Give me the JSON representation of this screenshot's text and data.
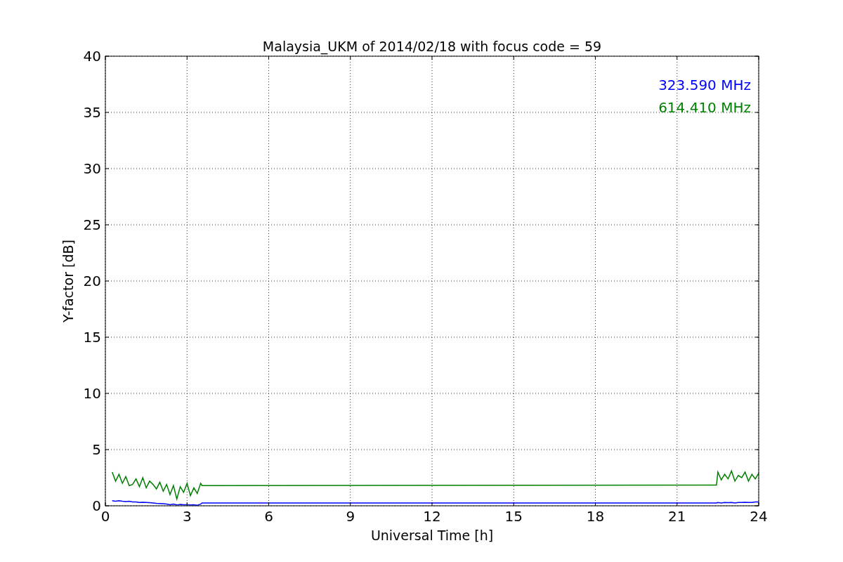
{
  "figure": {
    "chart_data": {
      "type": "line",
      "title": "Malaysia_UKM of 2014/02/18 with focus code = 59",
      "xlabel": "Universal Time [h]",
      "ylabel": "Y-factor [dB]",
      "x": [
        0.25,
        0.375,
        0.5,
        0.625,
        0.75,
        0.875,
        1,
        1.125,
        1.25,
        1.375,
        1.5,
        1.625,
        1.75,
        1.875,
        2,
        2.125,
        2.25,
        2.375,
        2.5,
        2.625,
        2.75,
        2.875,
        3,
        3.125,
        3.25,
        3.375,
        3.5,
        3.55,
        22.45,
        22.5,
        22.625,
        22.75,
        22.875,
        23,
        23.125,
        23.25,
        23.375,
        23.5,
        23.625,
        23.75,
        23.875,
        24
      ],
      "series": [
        {
          "name": "323.590 MHz",
          "color": "#0000ff",
          "values": [
            0.45,
            0.4,
            0.45,
            0.4,
            0.38,
            0.4,
            0.35,
            0.35,
            0.3,
            0.32,
            0.3,
            0.28,
            0.25,
            0.22,
            0.2,
            0.18,
            0.15,
            0.1,
            0.15,
            0.08,
            0.12,
            0.1,
            0.1,
            0.08,
            0.1,
            0.05,
            0.15,
            0.25,
            0.25,
            0.3,
            0.25,
            0.3,
            0.28,
            0.3,
            0.25,
            0.3,
            0.3,
            0.32,
            0.3,
            0.3,
            0.35,
            0.35
          ]
        },
        {
          "name": "614.410 MHz",
          "color": "#008000",
          "values": [
            3.0,
            2.2,
            2.8,
            2.0,
            2.6,
            1.8,
            1.9,
            2.4,
            1.7,
            2.5,
            1.6,
            2.2,
            1.9,
            1.5,
            2.1,
            1.3,
            1.9,
            1.0,
            1.8,
            0.6,
            1.7,
            1.2,
            2.0,
            0.9,
            1.6,
            1.1,
            2.0,
            1.8,
            1.85,
            3.0,
            2.3,
            2.8,
            2.4,
            3.1,
            2.2,
            2.7,
            2.5,
            3.0,
            2.2,
            2.8,
            2.4,
            2.9
          ]
        }
      ],
      "grid": true,
      "xlim": [
        0,
        24
      ],
      "ylim": [
        0,
        40
      ],
      "xticks": [
        0,
        3,
        6,
        9,
        12,
        15,
        18,
        21,
        24
      ],
      "yticks": [
        0,
        5,
        10,
        15,
        20,
        25,
        30,
        35,
        40
      ]
    }
  }
}
